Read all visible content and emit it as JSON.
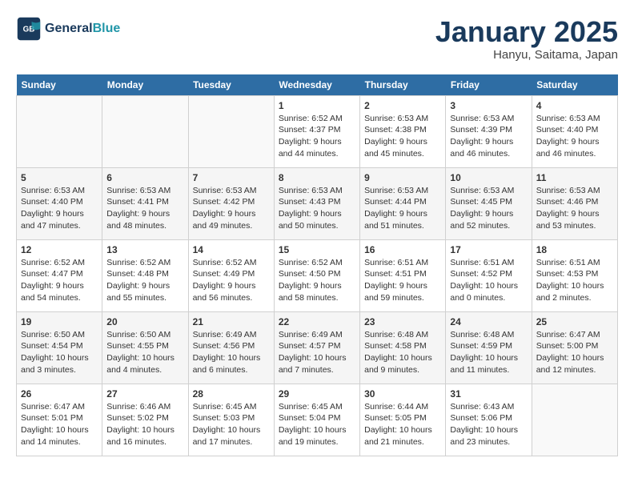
{
  "logo": {
    "line1": "General",
    "line2": "Blue"
  },
  "title": "January 2025",
  "location": "Hanyu, Saitama, Japan",
  "weekdays": [
    "Sunday",
    "Monday",
    "Tuesday",
    "Wednesday",
    "Thursday",
    "Friday",
    "Saturday"
  ],
  "weeks": [
    [
      {
        "day": "",
        "info": ""
      },
      {
        "day": "",
        "info": ""
      },
      {
        "day": "",
        "info": ""
      },
      {
        "day": "1",
        "info": "Sunrise: 6:52 AM\nSunset: 4:37 PM\nDaylight: 9 hours\nand 44 minutes."
      },
      {
        "day": "2",
        "info": "Sunrise: 6:53 AM\nSunset: 4:38 PM\nDaylight: 9 hours\nand 45 minutes."
      },
      {
        "day": "3",
        "info": "Sunrise: 6:53 AM\nSunset: 4:39 PM\nDaylight: 9 hours\nand 46 minutes."
      },
      {
        "day": "4",
        "info": "Sunrise: 6:53 AM\nSunset: 4:40 PM\nDaylight: 9 hours\nand 46 minutes."
      }
    ],
    [
      {
        "day": "5",
        "info": "Sunrise: 6:53 AM\nSunset: 4:40 PM\nDaylight: 9 hours\nand 47 minutes."
      },
      {
        "day": "6",
        "info": "Sunrise: 6:53 AM\nSunset: 4:41 PM\nDaylight: 9 hours\nand 48 minutes."
      },
      {
        "day": "7",
        "info": "Sunrise: 6:53 AM\nSunset: 4:42 PM\nDaylight: 9 hours\nand 49 minutes."
      },
      {
        "day": "8",
        "info": "Sunrise: 6:53 AM\nSunset: 4:43 PM\nDaylight: 9 hours\nand 50 minutes."
      },
      {
        "day": "9",
        "info": "Sunrise: 6:53 AM\nSunset: 4:44 PM\nDaylight: 9 hours\nand 51 minutes."
      },
      {
        "day": "10",
        "info": "Sunrise: 6:53 AM\nSunset: 4:45 PM\nDaylight: 9 hours\nand 52 minutes."
      },
      {
        "day": "11",
        "info": "Sunrise: 6:53 AM\nSunset: 4:46 PM\nDaylight: 9 hours\nand 53 minutes."
      }
    ],
    [
      {
        "day": "12",
        "info": "Sunrise: 6:52 AM\nSunset: 4:47 PM\nDaylight: 9 hours\nand 54 minutes."
      },
      {
        "day": "13",
        "info": "Sunrise: 6:52 AM\nSunset: 4:48 PM\nDaylight: 9 hours\nand 55 minutes."
      },
      {
        "day": "14",
        "info": "Sunrise: 6:52 AM\nSunset: 4:49 PM\nDaylight: 9 hours\nand 56 minutes."
      },
      {
        "day": "15",
        "info": "Sunrise: 6:52 AM\nSunset: 4:50 PM\nDaylight: 9 hours\nand 58 minutes."
      },
      {
        "day": "16",
        "info": "Sunrise: 6:51 AM\nSunset: 4:51 PM\nDaylight: 9 hours\nand 59 minutes."
      },
      {
        "day": "17",
        "info": "Sunrise: 6:51 AM\nSunset: 4:52 PM\nDaylight: 10 hours\nand 0 minutes."
      },
      {
        "day": "18",
        "info": "Sunrise: 6:51 AM\nSunset: 4:53 PM\nDaylight: 10 hours\nand 2 minutes."
      }
    ],
    [
      {
        "day": "19",
        "info": "Sunrise: 6:50 AM\nSunset: 4:54 PM\nDaylight: 10 hours\nand 3 minutes."
      },
      {
        "day": "20",
        "info": "Sunrise: 6:50 AM\nSunset: 4:55 PM\nDaylight: 10 hours\nand 4 minutes."
      },
      {
        "day": "21",
        "info": "Sunrise: 6:49 AM\nSunset: 4:56 PM\nDaylight: 10 hours\nand 6 minutes."
      },
      {
        "day": "22",
        "info": "Sunrise: 6:49 AM\nSunset: 4:57 PM\nDaylight: 10 hours\nand 7 minutes."
      },
      {
        "day": "23",
        "info": "Sunrise: 6:48 AM\nSunset: 4:58 PM\nDaylight: 10 hours\nand 9 minutes."
      },
      {
        "day": "24",
        "info": "Sunrise: 6:48 AM\nSunset: 4:59 PM\nDaylight: 10 hours\nand 11 minutes."
      },
      {
        "day": "25",
        "info": "Sunrise: 6:47 AM\nSunset: 5:00 PM\nDaylight: 10 hours\nand 12 minutes."
      }
    ],
    [
      {
        "day": "26",
        "info": "Sunrise: 6:47 AM\nSunset: 5:01 PM\nDaylight: 10 hours\nand 14 minutes."
      },
      {
        "day": "27",
        "info": "Sunrise: 6:46 AM\nSunset: 5:02 PM\nDaylight: 10 hours\nand 16 minutes."
      },
      {
        "day": "28",
        "info": "Sunrise: 6:45 AM\nSunset: 5:03 PM\nDaylight: 10 hours\nand 17 minutes."
      },
      {
        "day": "29",
        "info": "Sunrise: 6:45 AM\nSunset: 5:04 PM\nDaylight: 10 hours\nand 19 minutes."
      },
      {
        "day": "30",
        "info": "Sunrise: 6:44 AM\nSunset: 5:05 PM\nDaylight: 10 hours\nand 21 minutes."
      },
      {
        "day": "31",
        "info": "Sunrise: 6:43 AM\nSunset: 5:06 PM\nDaylight: 10 hours\nand 23 minutes."
      },
      {
        "day": "",
        "info": ""
      }
    ]
  ]
}
